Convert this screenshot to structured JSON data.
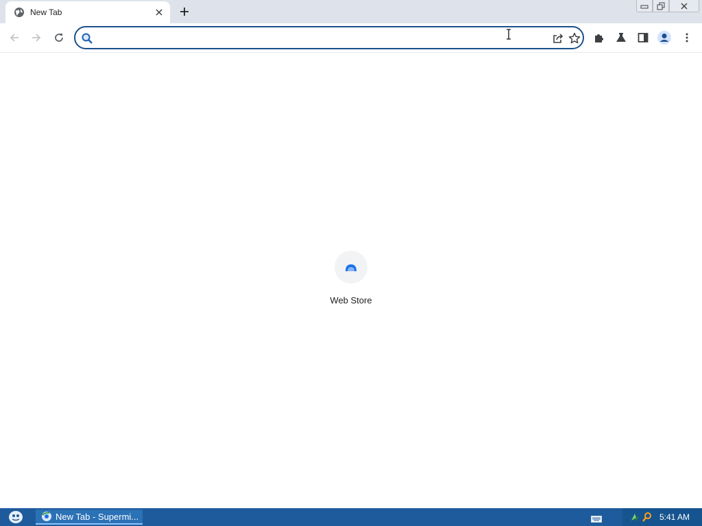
{
  "tab": {
    "title": "New Tab",
    "favicon": "globe-icon"
  },
  "toolbar": {
    "back_icon": "arrow-left-icon",
    "forward_icon": "arrow-right-icon",
    "reload_icon": "reload-icon",
    "omnibox": {
      "value": "",
      "placeholder": ""
    },
    "right_icons": [
      "puzzle-icon",
      "flask-icon",
      "side-panel-icon",
      "profile-icon",
      "menu-icon"
    ]
  },
  "content": {
    "shortcuts": [
      {
        "label": "Web Store",
        "icon": "web-store-icon"
      }
    ]
  },
  "taskbar": {
    "window_label": "New Tab - Supermi...",
    "clock": "5:41 AM"
  },
  "colors": {
    "tabstrip": "#dee3eb",
    "omnibox_border": "#1a4f8b",
    "taskbar": "#1d5b9c",
    "accent_blue": "#1a73e8"
  }
}
